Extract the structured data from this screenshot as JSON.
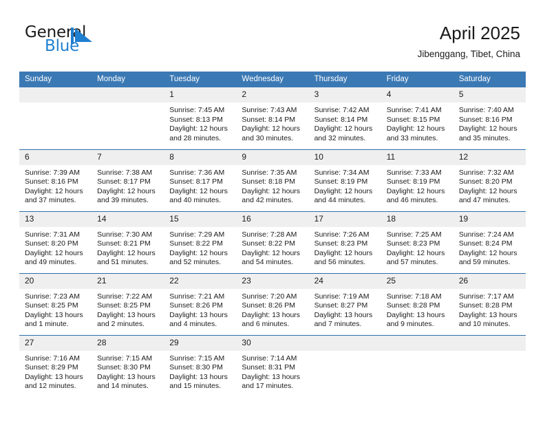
{
  "brand": {
    "name_dark": "General",
    "name_light": "Blue",
    "mark": "triangle-flag-logo",
    "color_dark": "#1a1a1a",
    "color_light": "#1f7fd0"
  },
  "header": {
    "title": "April 2025",
    "subtitle": "Jibenggang, Tibet, China",
    "header_bg": "#3b79b5",
    "daynum_bg": "#efefef",
    "row_line": "#2f6eaa"
  },
  "weekdays": [
    "Sunday",
    "Monday",
    "Tuesday",
    "Wednesday",
    "Thursday",
    "Friday",
    "Saturday"
  ],
  "weeks": [
    [
      {
        "day": "",
        "empty": true
      },
      {
        "day": "",
        "empty": true
      },
      {
        "day": "1",
        "sunrise": "Sunrise: 7:45 AM",
        "sunset": "Sunset: 8:13 PM",
        "daylight1": "Daylight: 12 hours",
        "daylight2": "and 28 minutes."
      },
      {
        "day": "2",
        "sunrise": "Sunrise: 7:43 AM",
        "sunset": "Sunset: 8:14 PM",
        "daylight1": "Daylight: 12 hours",
        "daylight2": "and 30 minutes."
      },
      {
        "day": "3",
        "sunrise": "Sunrise: 7:42 AM",
        "sunset": "Sunset: 8:14 PM",
        "daylight1": "Daylight: 12 hours",
        "daylight2": "and 32 minutes."
      },
      {
        "day": "4",
        "sunrise": "Sunrise: 7:41 AM",
        "sunset": "Sunset: 8:15 PM",
        "daylight1": "Daylight: 12 hours",
        "daylight2": "and 33 minutes."
      },
      {
        "day": "5",
        "sunrise": "Sunrise: 7:40 AM",
        "sunset": "Sunset: 8:16 PM",
        "daylight1": "Daylight: 12 hours",
        "daylight2": "and 35 minutes."
      }
    ],
    [
      {
        "day": "6",
        "sunrise": "Sunrise: 7:39 AM",
        "sunset": "Sunset: 8:16 PM",
        "daylight1": "Daylight: 12 hours",
        "daylight2": "and 37 minutes."
      },
      {
        "day": "7",
        "sunrise": "Sunrise: 7:38 AM",
        "sunset": "Sunset: 8:17 PM",
        "daylight1": "Daylight: 12 hours",
        "daylight2": "and 39 minutes."
      },
      {
        "day": "8",
        "sunrise": "Sunrise: 7:36 AM",
        "sunset": "Sunset: 8:17 PM",
        "daylight1": "Daylight: 12 hours",
        "daylight2": "and 40 minutes."
      },
      {
        "day": "9",
        "sunrise": "Sunrise: 7:35 AM",
        "sunset": "Sunset: 8:18 PM",
        "daylight1": "Daylight: 12 hours",
        "daylight2": "and 42 minutes."
      },
      {
        "day": "10",
        "sunrise": "Sunrise: 7:34 AM",
        "sunset": "Sunset: 8:19 PM",
        "daylight1": "Daylight: 12 hours",
        "daylight2": "and 44 minutes."
      },
      {
        "day": "11",
        "sunrise": "Sunrise: 7:33 AM",
        "sunset": "Sunset: 8:19 PM",
        "daylight1": "Daylight: 12 hours",
        "daylight2": "and 46 minutes."
      },
      {
        "day": "12",
        "sunrise": "Sunrise: 7:32 AM",
        "sunset": "Sunset: 8:20 PM",
        "daylight1": "Daylight: 12 hours",
        "daylight2": "and 47 minutes."
      }
    ],
    [
      {
        "day": "13",
        "sunrise": "Sunrise: 7:31 AM",
        "sunset": "Sunset: 8:20 PM",
        "daylight1": "Daylight: 12 hours",
        "daylight2": "and 49 minutes."
      },
      {
        "day": "14",
        "sunrise": "Sunrise: 7:30 AM",
        "sunset": "Sunset: 8:21 PM",
        "daylight1": "Daylight: 12 hours",
        "daylight2": "and 51 minutes."
      },
      {
        "day": "15",
        "sunrise": "Sunrise: 7:29 AM",
        "sunset": "Sunset: 8:22 PM",
        "daylight1": "Daylight: 12 hours",
        "daylight2": "and 52 minutes."
      },
      {
        "day": "16",
        "sunrise": "Sunrise: 7:28 AM",
        "sunset": "Sunset: 8:22 PM",
        "daylight1": "Daylight: 12 hours",
        "daylight2": "and 54 minutes."
      },
      {
        "day": "17",
        "sunrise": "Sunrise: 7:26 AM",
        "sunset": "Sunset: 8:23 PM",
        "daylight1": "Daylight: 12 hours",
        "daylight2": "and 56 minutes."
      },
      {
        "day": "18",
        "sunrise": "Sunrise: 7:25 AM",
        "sunset": "Sunset: 8:23 PM",
        "daylight1": "Daylight: 12 hours",
        "daylight2": "and 57 minutes."
      },
      {
        "day": "19",
        "sunrise": "Sunrise: 7:24 AM",
        "sunset": "Sunset: 8:24 PM",
        "daylight1": "Daylight: 12 hours",
        "daylight2": "and 59 minutes."
      }
    ],
    [
      {
        "day": "20",
        "sunrise": "Sunrise: 7:23 AM",
        "sunset": "Sunset: 8:25 PM",
        "daylight1": "Daylight: 13 hours",
        "daylight2": "and 1 minute."
      },
      {
        "day": "21",
        "sunrise": "Sunrise: 7:22 AM",
        "sunset": "Sunset: 8:25 PM",
        "daylight1": "Daylight: 13 hours",
        "daylight2": "and 2 minutes."
      },
      {
        "day": "22",
        "sunrise": "Sunrise: 7:21 AM",
        "sunset": "Sunset: 8:26 PM",
        "daylight1": "Daylight: 13 hours",
        "daylight2": "and 4 minutes."
      },
      {
        "day": "23",
        "sunrise": "Sunrise: 7:20 AM",
        "sunset": "Sunset: 8:26 PM",
        "daylight1": "Daylight: 13 hours",
        "daylight2": "and 6 minutes."
      },
      {
        "day": "24",
        "sunrise": "Sunrise: 7:19 AM",
        "sunset": "Sunset: 8:27 PM",
        "daylight1": "Daylight: 13 hours",
        "daylight2": "and 7 minutes."
      },
      {
        "day": "25",
        "sunrise": "Sunrise: 7:18 AM",
        "sunset": "Sunset: 8:28 PM",
        "daylight1": "Daylight: 13 hours",
        "daylight2": "and 9 minutes."
      },
      {
        "day": "26",
        "sunrise": "Sunrise: 7:17 AM",
        "sunset": "Sunset: 8:28 PM",
        "daylight1": "Daylight: 13 hours",
        "daylight2": "and 10 minutes."
      }
    ],
    [
      {
        "day": "27",
        "sunrise": "Sunrise: 7:16 AM",
        "sunset": "Sunset: 8:29 PM",
        "daylight1": "Daylight: 13 hours",
        "daylight2": "and 12 minutes."
      },
      {
        "day": "28",
        "sunrise": "Sunrise: 7:15 AM",
        "sunset": "Sunset: 8:30 PM",
        "daylight1": "Daylight: 13 hours",
        "daylight2": "and 14 minutes."
      },
      {
        "day": "29",
        "sunrise": "Sunrise: 7:15 AM",
        "sunset": "Sunset: 8:30 PM",
        "daylight1": "Daylight: 13 hours",
        "daylight2": "and 15 minutes."
      },
      {
        "day": "30",
        "sunrise": "Sunrise: 7:14 AM",
        "sunset": "Sunset: 8:31 PM",
        "daylight1": "Daylight: 13 hours",
        "daylight2": "and 17 minutes."
      },
      {
        "day": "",
        "empty": true
      },
      {
        "day": "",
        "empty": true
      },
      {
        "day": "",
        "empty": true
      }
    ]
  ]
}
